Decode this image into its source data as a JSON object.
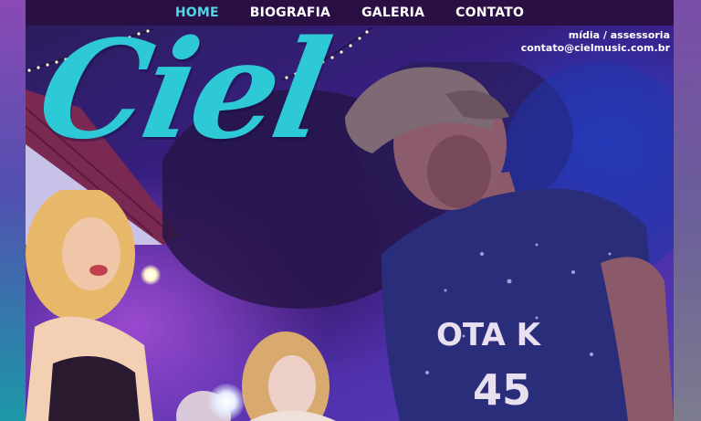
{
  "nav": {
    "items": [
      {
        "label": "HOME",
        "active": true
      },
      {
        "label": "BIOGRAFIA",
        "active": false
      },
      {
        "label": "GALERIA",
        "active": false
      },
      {
        "label": "CONTATO",
        "active": false
      }
    ]
  },
  "hero": {
    "logo_text": "Ciel",
    "contact_label": "mídia / assessoria",
    "contact_email": "contato@cielmusic.com.br",
    "shirt_print_line1": "OTA K",
    "shirt_print_line2": "45"
  },
  "colors": {
    "accent": "#4fd6e6",
    "logo": "#2ec9d6",
    "navbar_bg": "#2a0f44"
  }
}
